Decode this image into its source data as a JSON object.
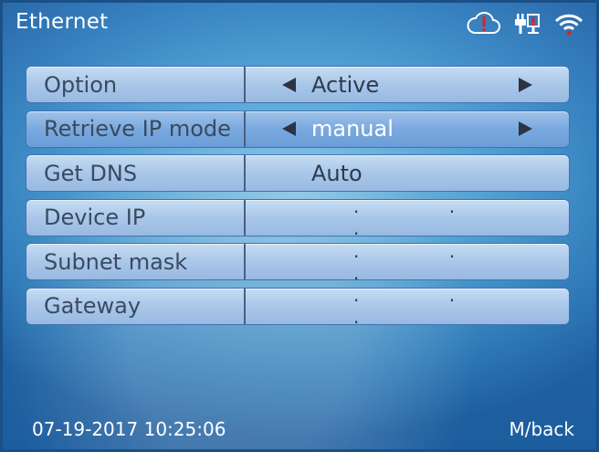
{
  "header": {
    "title": "Ethernet",
    "icons": [
      "cloud-alert-icon",
      "network-cable-icon",
      "wifi-icon"
    ],
    "alert_color": "#e02020"
  },
  "rows": [
    {
      "label": "Option",
      "value": "Active",
      "has_arrows": true
    },
    {
      "label": "Retrieve IP mode",
      "value": "manual",
      "has_arrows": true,
      "active": true
    },
    {
      "label": "Get DNS",
      "value": "Auto",
      "has_arrows": false
    },
    {
      "label": "Device IP",
      "value": ". . .",
      "has_arrows": false
    },
    {
      "label": "Subnet mask",
      "value": ". . .",
      "has_arrows": false
    },
    {
      "label": "Gateway",
      "value": ". . .",
      "has_arrows": false
    }
  ],
  "footer": {
    "datetime": "07-19-2017 10:25:06",
    "back_label": "M/back"
  }
}
